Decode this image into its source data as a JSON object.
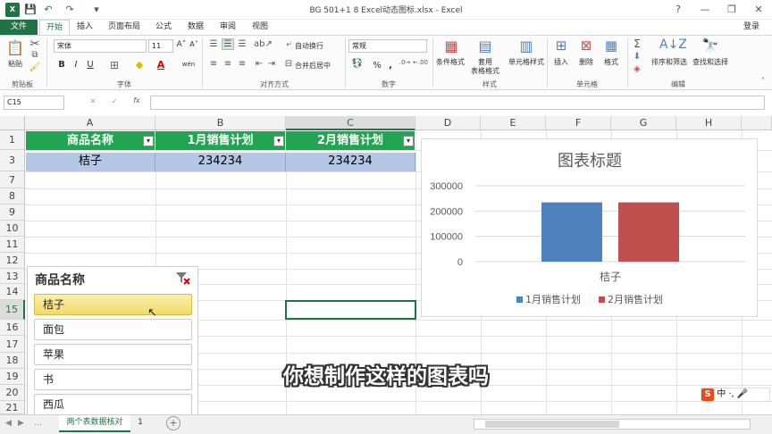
{
  "window": {
    "title": "BG 501+1 8 Excel动态图标.xlsx - Excel",
    "help": "?",
    "minimize": "—",
    "restore": "❐",
    "close": "✕",
    "login": "登录"
  },
  "qat": {
    "save": "💾",
    "undo": "↶",
    "redo": "↷",
    "custom": "▾"
  },
  "tabs": [
    "文件",
    "开始",
    "插入",
    "页面布局",
    "公式",
    "数据",
    "审阅",
    "视图"
  ],
  "ribbon": {
    "clipboard": {
      "label": "剪贴板",
      "paste": "粘贴"
    },
    "font": {
      "label": "字体",
      "name": "宋体",
      "size": "11",
      "grow": "A˄",
      "shrink": "A˅",
      "bold": "B",
      "italic": "I",
      "underline": "U",
      "border": "⊞",
      "fill": "◆",
      "color": "A",
      "wen": "wén"
    },
    "alignment": {
      "label": "对齐方式",
      "wrap": "自动换行",
      "merge": "合并后居中"
    },
    "number": {
      "label": "数字",
      "format": "常规",
      "percent": "%",
      "comma": ","
    },
    "styles": {
      "label": "样式",
      "conditional": "条件格式",
      "table_line1": "套用",
      "table_line2": "表格格式",
      "cell_styles": "单元格样式"
    },
    "cells": {
      "label": "单元格",
      "insert": "插入",
      "delete": "删除",
      "format": "格式"
    },
    "editing": {
      "label": "编辑",
      "sort": "排序和筛选",
      "find": "查找和选择"
    }
  },
  "formula_bar": {
    "name_box": "C15",
    "fx": "fx",
    "cancel": "✕",
    "enter": "✓",
    "value": ""
  },
  "columns": [
    "A",
    "B",
    "C",
    "D",
    "E",
    "F",
    "G",
    "H"
  ],
  "rows": [
    "1",
    "3",
    "7",
    "8",
    "9",
    "10",
    "11",
    "12",
    "13",
    "14",
    "15",
    "16",
    "17",
    "18",
    "19",
    "20",
    "21"
  ],
  "table": {
    "headers": [
      "商品名称",
      "1月销售计划",
      "2月销售计划"
    ],
    "rows": [
      [
        "桔子",
        "234234",
        "234234"
      ]
    ]
  },
  "chart_data": {
    "type": "bar",
    "title": "图表标题",
    "categories": [
      "桔子"
    ],
    "series": [
      {
        "name": "1月销售计划",
        "values": [
          234234
        ],
        "color": "#4f81bd"
      },
      {
        "name": "2月销售计划",
        "values": [
          234234
        ],
        "color": "#c0504d"
      }
    ],
    "ylim": [
      0,
      300000
    ],
    "yticks": [
      "0",
      "100000",
      "200000",
      "300000"
    ],
    "grid": true,
    "legend": "bottom"
  },
  "slicer": {
    "title": "商品名称",
    "clear_icon": "filter-clear-icon",
    "items": [
      "桔子",
      "面包",
      "苹果",
      "书",
      "西瓜"
    ],
    "selected": 0
  },
  "sheet_tabs": {
    "active": "两个表数据核对",
    "other": "1",
    "add": "+"
  },
  "subtitle": "你想制作这样的图表吗",
  "ime": {
    "logo": "S",
    "text": "中",
    "items": "·,"
  },
  "colors": {
    "accent": "#217346",
    "header_green": "#22a552",
    "data_blue": "#b4c7e7",
    "selected_item": "#f7e58a"
  }
}
